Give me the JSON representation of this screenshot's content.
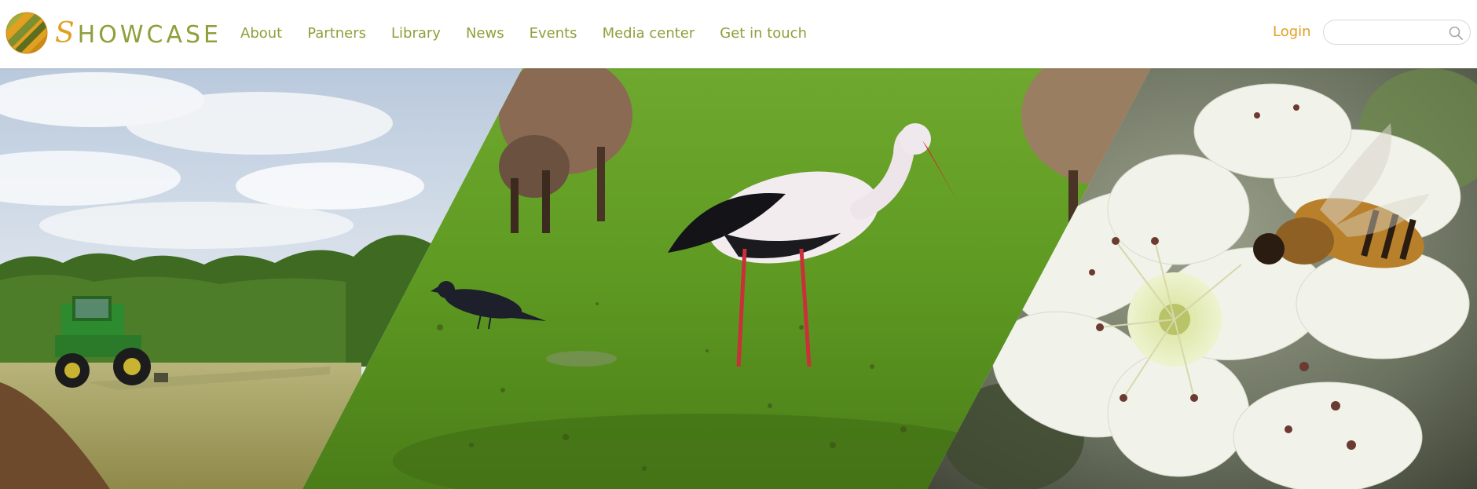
{
  "brand": {
    "name_initial": "S",
    "name_rest": "HOWCASE"
  },
  "nav": {
    "items": [
      {
        "label": "About"
      },
      {
        "label": "Partners"
      },
      {
        "label": "Library"
      },
      {
        "label": "News"
      },
      {
        "label": "Events"
      },
      {
        "label": "Media center"
      },
      {
        "label": "Get in touch"
      }
    ]
  },
  "header": {
    "login_label": "Login"
  },
  "search": {
    "placeholder": "",
    "icon": "search-icon"
  },
  "hero": {
    "panels": [
      "farmland-tractor-photo",
      "stork-meadow-photo",
      "bee-blossom-photo"
    ]
  },
  "colors": {
    "brand_green": "#8ea03a",
    "brand_orange": "#e2a021"
  }
}
